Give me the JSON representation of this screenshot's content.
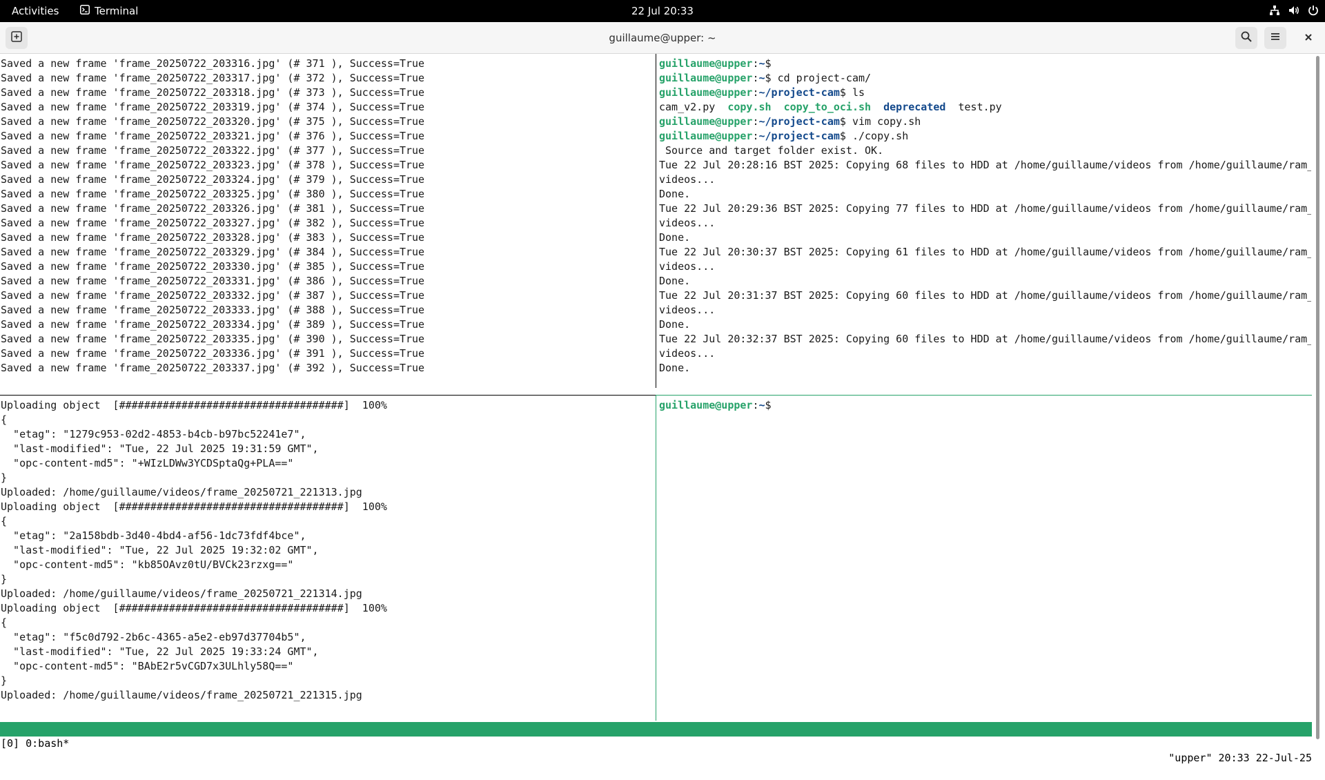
{
  "topbar": {
    "activities": "Activities",
    "app_name": "Terminal",
    "clock": "22 Jul  20:33",
    "icons": [
      "network-icon",
      "volume-icon",
      "power-icon"
    ]
  },
  "window": {
    "title": "guillaume@upper: ~",
    "icons": [
      "new-tab-icon",
      "search-icon",
      "hamburger-menu-icon",
      "close-icon"
    ]
  },
  "pane_top_left": [
    "Saved a new frame 'frame_20250722_203316.jpg' (# 371 ), Success=True",
    "Saved a new frame 'frame_20250722_203317.jpg' (# 372 ), Success=True",
    "Saved a new frame 'frame_20250722_203318.jpg' (# 373 ), Success=True",
    "Saved a new frame 'frame_20250722_203319.jpg' (# 374 ), Success=True",
    "Saved a new frame 'frame_20250722_203320.jpg' (# 375 ), Success=True",
    "Saved a new frame 'frame_20250722_203321.jpg' (# 376 ), Success=True",
    "Saved a new frame 'frame_20250722_203322.jpg' (# 377 ), Success=True",
    "Saved a new frame 'frame_20250722_203323.jpg' (# 378 ), Success=True",
    "Saved a new frame 'frame_20250722_203324.jpg' (# 379 ), Success=True",
    "Saved a new frame 'frame_20250722_203325.jpg' (# 380 ), Success=True",
    "Saved a new frame 'frame_20250722_203326.jpg' (# 381 ), Success=True",
    "Saved a new frame 'frame_20250722_203327.jpg' (# 382 ), Success=True",
    "Saved a new frame 'frame_20250722_203328.jpg' (# 383 ), Success=True",
    "Saved a new frame 'frame_20250722_203329.jpg' (# 384 ), Success=True",
    "Saved a new frame 'frame_20250722_203330.jpg' (# 385 ), Success=True",
    "Saved a new frame 'frame_20250722_203331.jpg' (# 386 ), Success=True",
    "Saved a new frame 'frame_20250722_203332.jpg' (# 387 ), Success=True",
    "Saved a new frame 'frame_20250722_203333.jpg' (# 388 ), Success=True",
    "Saved a new frame 'frame_20250722_203334.jpg' (# 389 ), Success=True",
    "Saved a new frame 'frame_20250722_203335.jpg' (# 390 ), Success=True",
    "Saved a new frame 'frame_20250722_203336.jpg' (# 391 ), Success=True",
    "Saved a new frame 'frame_20250722_203337.jpg' (# 392 ), Success=True"
  ],
  "pane_top_right": {
    "prompt_user": "guillaume@upper",
    "lines": [
      {
        "cwd": "~",
        "cmd": ""
      },
      {
        "cwd": "~",
        "cmd": " cd project-cam/"
      },
      {
        "cwd": "~/project-cam",
        "cmd": " ls"
      },
      {
        "ls": [
          "cam_v2.py",
          "copy.sh",
          "copy_to_oci.sh",
          "deprecated",
          "test.py"
        ]
      },
      {
        "cwd": "~/project-cam",
        "cmd": " vim copy.sh"
      },
      {
        "cwd": "~/project-cam",
        "cmd": " ./copy.sh"
      },
      {
        "text": " Source and target folder exist. OK."
      },
      {
        "text": "Tue 22 Jul 20:28:16 BST 2025: Copying 68 files to HDD at /home/guillaume/videos from /home/guillaume/ram_"
      },
      {
        "text": "videos..."
      },
      {
        "text": "Done."
      },
      {
        "text": "Tue 22 Jul 20:29:36 BST 2025: Copying 77 files to HDD at /home/guillaume/videos from /home/guillaume/ram_"
      },
      {
        "text": "videos..."
      },
      {
        "text": "Done."
      },
      {
        "text": "Tue 22 Jul 20:30:37 BST 2025: Copying 61 files to HDD at /home/guillaume/videos from /home/guillaume/ram_"
      },
      {
        "text": "videos..."
      },
      {
        "text": "Done."
      },
      {
        "text": "Tue 22 Jul 20:31:37 BST 2025: Copying 60 files to HDD at /home/guillaume/videos from /home/guillaume/ram_"
      },
      {
        "text": "videos..."
      },
      {
        "text": "Done."
      },
      {
        "text": "Tue 22 Jul 20:32:37 BST 2025: Copying 60 files to HDD at /home/guillaume/videos from /home/guillaume/ram_"
      },
      {
        "text": "videos..."
      },
      {
        "text": "Done."
      }
    ]
  },
  "pane_bottom_left": [
    "Uploading object  [####################################]  100%",
    "{",
    "  \"etag\": \"1279c953-02d2-4853-b4cb-b97bc52241e7\",",
    "  \"last-modified\": \"Tue, 22 Jul 2025 19:31:59 GMT\",",
    "  \"opc-content-md5\": \"+WIzLDWw3YCDSptaQg+PLA==\"",
    "}",
    "Uploaded: /home/guillaume/videos/frame_20250721_221313.jpg",
    "Uploading object  [####################################]  100%",
    "{",
    "  \"etag\": \"2a158bdb-3d40-4bd4-af56-1dc73fdf4bce\",",
    "  \"last-modified\": \"Tue, 22 Jul 2025 19:32:02 GMT\",",
    "  \"opc-content-md5\": \"kb85OAvz0tU/BVCk23rzxg==\"",
    "}",
    "Uploaded: /home/guillaume/videos/frame_20250721_221314.jpg",
    "Uploading object  [####################################]  100%",
    "{",
    "  \"etag\": \"f5c0d792-2b6c-4365-a5e2-eb97d37704b5\",",
    "  \"last-modified\": \"Tue, 22 Jul 2025 19:33:24 GMT\",",
    "  \"opc-content-md5\": \"BAbE2r5vCGD7x3ULhly58Q==\"",
    "}",
    "Uploaded: /home/guillaume/videos/frame_20250721_221315.jpg"
  ],
  "pane_bottom_right": {
    "prompt_user": "guillaume@upper",
    "cwd": "~"
  },
  "tmux_status": {
    "left": "[0] 0:bash*",
    "right": "\"upper\" 20:33 22-Jul-25"
  },
  "colors": {
    "prompt_green": "#26a269",
    "directory_blue": "#12488b",
    "status_bar": "#26a269"
  }
}
